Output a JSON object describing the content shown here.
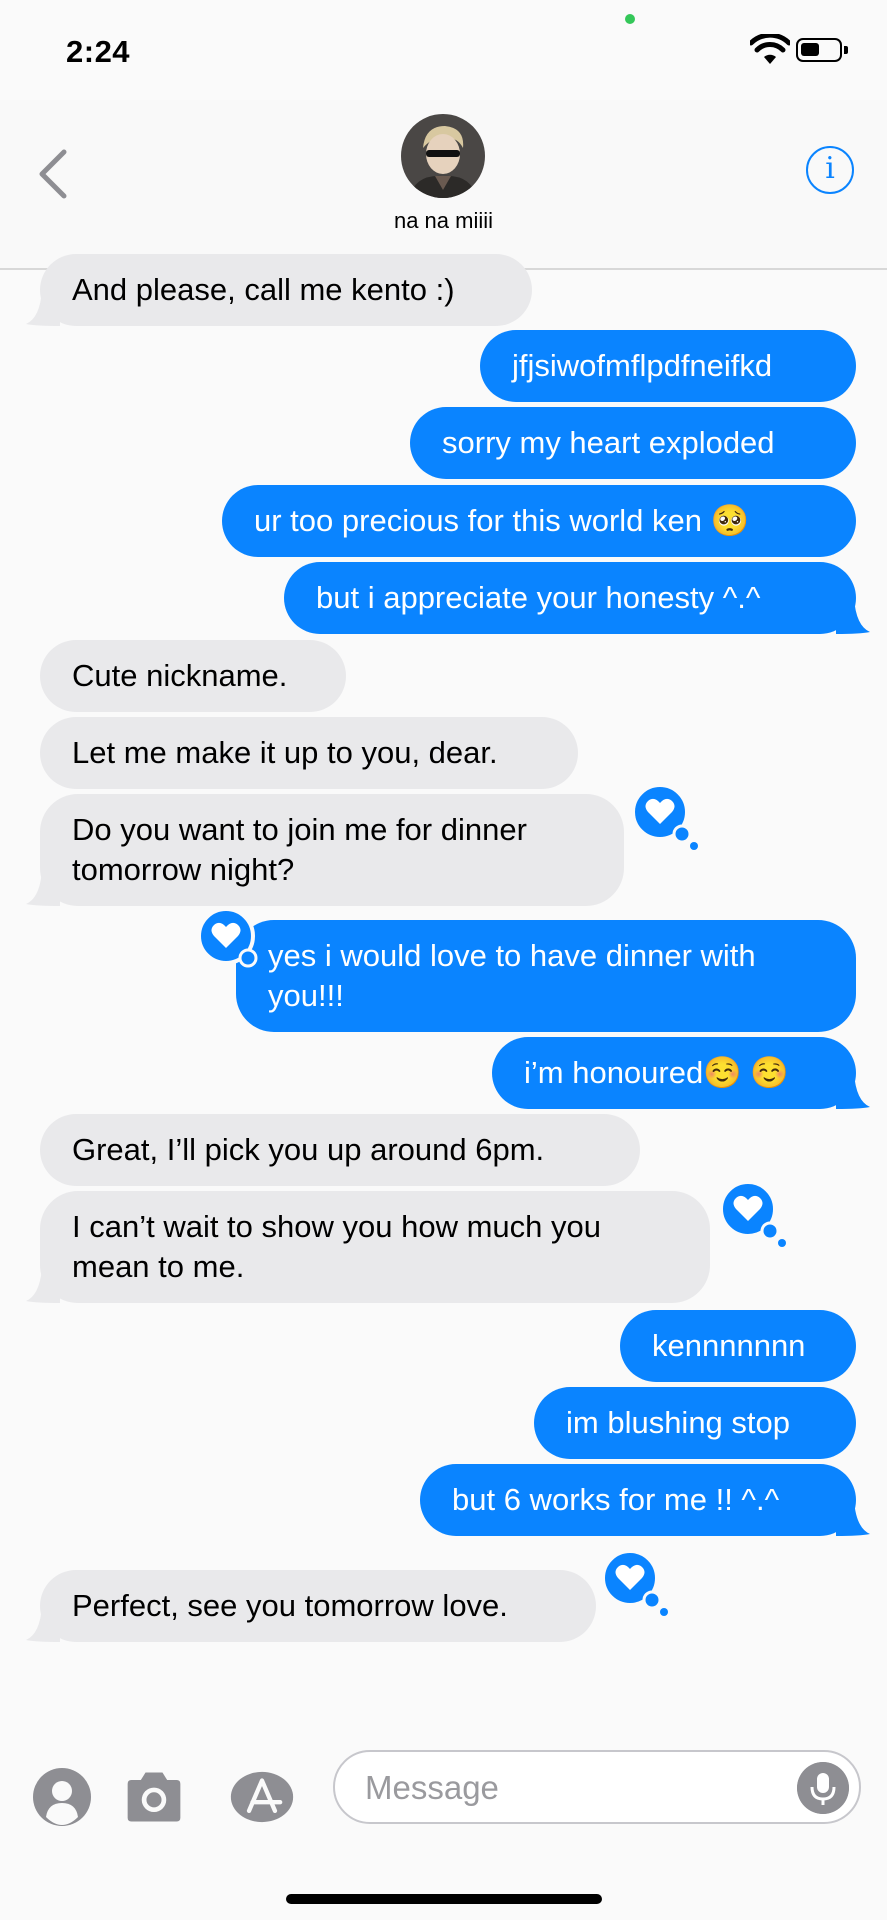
{
  "status_bar": {
    "time": "2:24"
  },
  "header": {
    "contact_name": "na na miiii"
  },
  "messages": [
    {
      "from": "them",
      "text": "And please, call me kento :)"
    },
    {
      "from": "me",
      "text": "jfjsiwofmflpdfneifkd"
    },
    {
      "from": "me",
      "text": "sorry my heart exploded"
    },
    {
      "from": "me",
      "text": "ur too precious for this world ken 🥺"
    },
    {
      "from": "me",
      "text": "but i appreciate your honesty ^.^"
    },
    {
      "from": "them",
      "text": "Cute nickname."
    },
    {
      "from": "them",
      "text": "Let me make it up to you, dear."
    },
    {
      "from": "them",
      "text": "Do you want to join me for dinner tomorrow night?",
      "reaction": "heart"
    },
    {
      "from": "me",
      "text": "yes i would love to have dinner with you!!!",
      "reaction": "heart"
    },
    {
      "from": "me",
      "text": "i’m honoured☺️ ☺️"
    },
    {
      "from": "them",
      "text": "Great, I’ll pick you up around 6pm."
    },
    {
      "from": "them",
      "text": "I can’t wait to show you how much you mean to me.",
      "reaction": "heart"
    },
    {
      "from": "me",
      "text": "kennnnnnn"
    },
    {
      "from": "me",
      "text": "im blushing stop"
    },
    {
      "from": "me",
      "text": "but 6 works for me !! ^.^"
    },
    {
      "from": "them",
      "text": "Perfect, see you tomorrow love.",
      "reaction": "heart"
    }
  ],
  "composer": {
    "placeholder": "Message"
  },
  "icons": {
    "back": "chevron-left-icon",
    "info": "info-circle-icon",
    "memoji": "memoji-icon",
    "camera": "camera-icon",
    "app_store": "app-store-icon",
    "mic": "microphone-icon",
    "reaction": "heart-tapback-icon"
  },
  "colors": {
    "accent": "#0a84ff",
    "sent_bubble": "#0a84ff",
    "received_bubble": "#e9e9eb",
    "background": "#fafafa"
  }
}
